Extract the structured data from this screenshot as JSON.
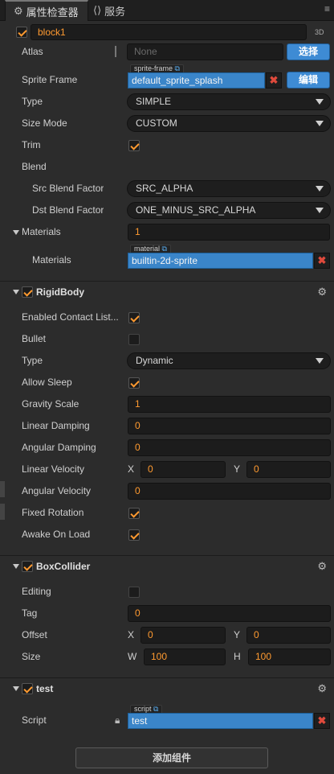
{
  "tabs": [
    {
      "label": "属性检查器",
      "icon": "gear-icon"
    },
    {
      "label": "服务",
      "icon": "service-icon"
    }
  ],
  "node": {
    "name": "block1",
    "mode": "3D",
    "enabled": true
  },
  "sprite": {
    "atlas_label": "Atlas",
    "atlas_placeholder": "None",
    "atlas_button": "选择",
    "sprite_frame_label": "Sprite Frame",
    "sprite_frame_tag": "sprite-frame",
    "sprite_frame_value": "default_sprite_splash",
    "sprite_frame_button": "编辑",
    "type_label": "Type",
    "type_value": "SIMPLE",
    "size_mode_label": "Size Mode",
    "size_mode_value": "CUSTOM",
    "trim_label": "Trim",
    "trim": true,
    "blend_label": "Blend",
    "src_blend_label": "Src Blend Factor",
    "src_blend_value": "SRC_ALPHA",
    "dst_blend_label": "Dst Blend Factor",
    "dst_blend_value": "ONE_MINUS_SRC_ALPHA",
    "materials_label": "Materials",
    "materials_count": "1",
    "material_item_label": "Materials",
    "material_tag": "material",
    "material_value": "builtin-2d-sprite"
  },
  "rigidbody": {
    "title": "RigidBody",
    "enabled": true,
    "enabled_contact_label": "Enabled Contact List...",
    "enabled_contact": true,
    "bullet_label": "Bullet",
    "bullet": false,
    "type_label": "Type",
    "type_value": "Dynamic",
    "allow_sleep_label": "Allow Sleep",
    "allow_sleep": true,
    "gravity_scale_label": "Gravity Scale",
    "gravity_scale": "1",
    "linear_damping_label": "Linear Damping",
    "linear_damping": "0",
    "angular_damping_label": "Angular Damping",
    "angular_damping": "0",
    "linear_velocity_label": "Linear Velocity",
    "lv_x_label": "X",
    "lv_x": "0",
    "lv_y_label": "Y",
    "lv_y": "0",
    "angular_velocity_label": "Angular Velocity",
    "angular_velocity": "0",
    "fixed_rotation_label": "Fixed Rotation",
    "fixed_rotation": true,
    "awake_on_load_label": "Awake On Load",
    "awake_on_load": true
  },
  "boxcollider": {
    "title": "BoxCollider",
    "enabled": true,
    "editing_label": "Editing",
    "editing": false,
    "tag_label": "Tag",
    "tag": "0",
    "offset_label": "Offset",
    "offset_x_label": "X",
    "offset_x": "0",
    "offset_y_label": "Y",
    "offset_y": "0",
    "size_label": "Size",
    "size_w_label": "W",
    "size_w": "100",
    "size_h_label": "H",
    "size_h": "100"
  },
  "test": {
    "title": "test",
    "enabled": true,
    "script_label": "Script",
    "script_tag": "script",
    "script_value": "test"
  },
  "add_component_label": "添加组件",
  "colors": {
    "accent": "#ff9a30",
    "asset_blue": "#3a85c9",
    "button_blue": "#3e8bd4",
    "remove_red": "#e04a3c",
    "panel_bg": "#2c2c2c"
  }
}
